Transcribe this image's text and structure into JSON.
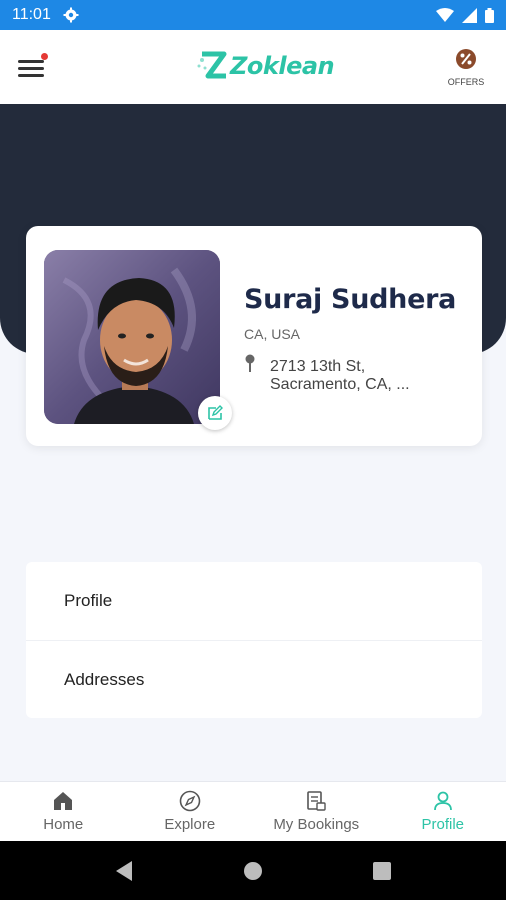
{
  "status_bar": {
    "time": "11:01"
  },
  "header": {
    "brand": "Zoklean",
    "offers_label": "OFFERS"
  },
  "profile": {
    "name": "Suraj Sudhera",
    "region": "CA, USA",
    "address_line1": "2713 13th St,",
    "address_line2": "Sacramento, CA, ..."
  },
  "menu": {
    "items": [
      {
        "label": "Profile"
      },
      {
        "label": "Addresses"
      }
    ]
  },
  "bottom_nav": {
    "items": [
      {
        "label": "Home",
        "icon": "home-icon"
      },
      {
        "label": "Explore",
        "icon": "compass-icon"
      },
      {
        "label": "My Bookings",
        "icon": "bookings-icon"
      },
      {
        "label": "Profile",
        "icon": "person-icon"
      }
    ],
    "active_index": 3
  },
  "colors": {
    "accent": "#2cc3a6",
    "dark": "#232b3b",
    "status_bar": "#1e88e5",
    "notification": "#e53935"
  }
}
